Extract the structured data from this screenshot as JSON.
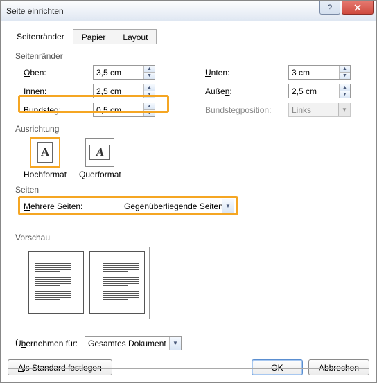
{
  "window": {
    "title": "Seite einrichten"
  },
  "tabs": {
    "margins": "Seitenränder",
    "paper": "Papier",
    "layout": "Layout"
  },
  "margins": {
    "group": "Seitenränder",
    "top_label_pre": "",
    "top_label_u": "O",
    "top_label_post": "ben:",
    "top_value": "3,5 cm",
    "bottom_label_pre": "",
    "bottom_label_u": "U",
    "bottom_label_post": "nten:",
    "bottom_value": "3 cm",
    "inner_label_pre": "I",
    "inner_label_u": "n",
    "inner_label_post": "nen:",
    "inner_value": "2,5 cm",
    "outer_label_pre": "Auße",
    "outer_label_u": "n",
    "outer_label_post": ":",
    "outer_value": "2,5 cm",
    "gutter_label_pre": "Bundst",
    "gutter_label_u": "e",
    "gutter_label_post": "g:",
    "gutter_value": "0,5 cm",
    "gutter_pos_label": "Bundstegposition:",
    "gutter_pos_value": "Links"
  },
  "orientation": {
    "group": "Ausrichtung",
    "portrait": "Hochformat",
    "landscape": "Querformat"
  },
  "pages": {
    "group": "Seiten",
    "multi_label_pre": "",
    "multi_label_u": "M",
    "multi_label_post": "ehrere Seiten:",
    "multi_value": "Gegenüberliegende Seiten"
  },
  "preview": {
    "group": "Vorschau"
  },
  "apply": {
    "label_pre": "Ü",
    "label_u": "b",
    "label_post": "ernehmen für:",
    "value": "Gesamtes Dokument"
  },
  "buttons": {
    "default_pre": "",
    "default_u": "A",
    "default_post": "ls Standard festlegen",
    "ok": "OK",
    "cancel": "Abbrechen"
  }
}
